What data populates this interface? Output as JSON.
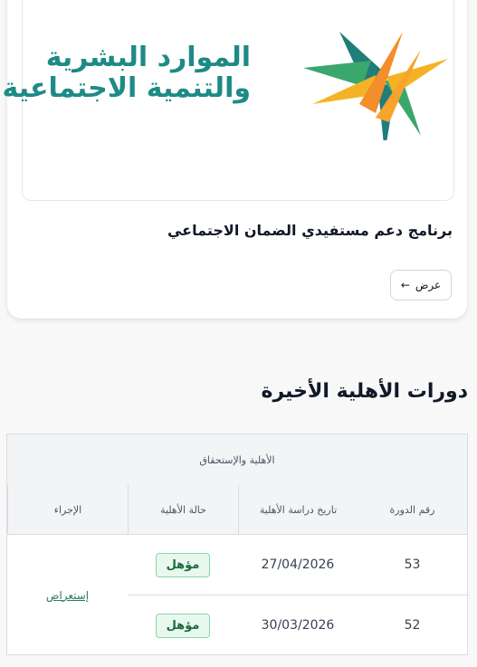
{
  "program_card": {
    "logo_text_line1": "الموارد البشرية",
    "logo_text_line2": "والتنمية الاجتماعية",
    "title": "برنامج دعم مستفيدي الضمان الاجتماعي",
    "view_button_label": "عرض",
    "view_button_icon": "arrow-left-icon"
  },
  "eligibility_section": {
    "title": "دورات الأهلية الأخيرة",
    "group_header": "الأهلية والإستحقاق",
    "columns": [
      "رقم الدورة",
      "تاريخ دراسة الأهلية",
      "حالة الأهلية",
      "الإجراء"
    ],
    "rows": [
      {
        "cycle": "53",
        "date": "27/04/2026",
        "status": "مؤهل"
      },
      {
        "cycle": "52",
        "date": "30/03/2026",
        "status": "مؤهل"
      }
    ],
    "action_label": "إستعراض"
  },
  "colors": {
    "brand_teal": "#1e8a86",
    "badge_green": "#1a6b3a",
    "link_green": "#2f7d5a"
  }
}
